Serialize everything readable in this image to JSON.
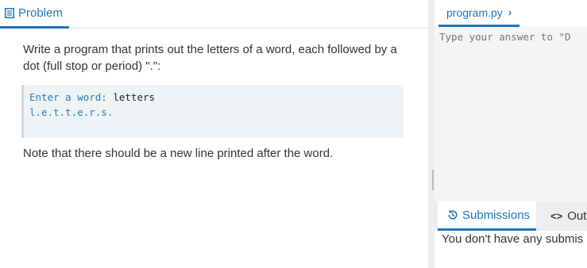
{
  "left": {
    "tab_label": "Problem",
    "problem_text": "Write a program that prints out the letters of a word, each followed by a dot (full stop or period) \".\":",
    "example": {
      "prompt": "Enter a word: ",
      "input": "letters",
      "output": "l.e.t.t.e.r.s."
    },
    "note_text": "Note that there should be a new line printed after the word."
  },
  "right": {
    "file_tab": "program.py",
    "editor_placeholder": "Type your answer to \"D",
    "bottom_tabs": {
      "submissions": "Submissions",
      "output": "Out"
    },
    "no_submissions": "You don't have any submis"
  },
  "colors": {
    "accent": "#1f74b8",
    "code_bg": "#eef3f6",
    "editor_bg": "#f2f4f5"
  },
  "icons": [
    "document-icon",
    "chevron-right-icon",
    "history-icon",
    "code-icon"
  ]
}
